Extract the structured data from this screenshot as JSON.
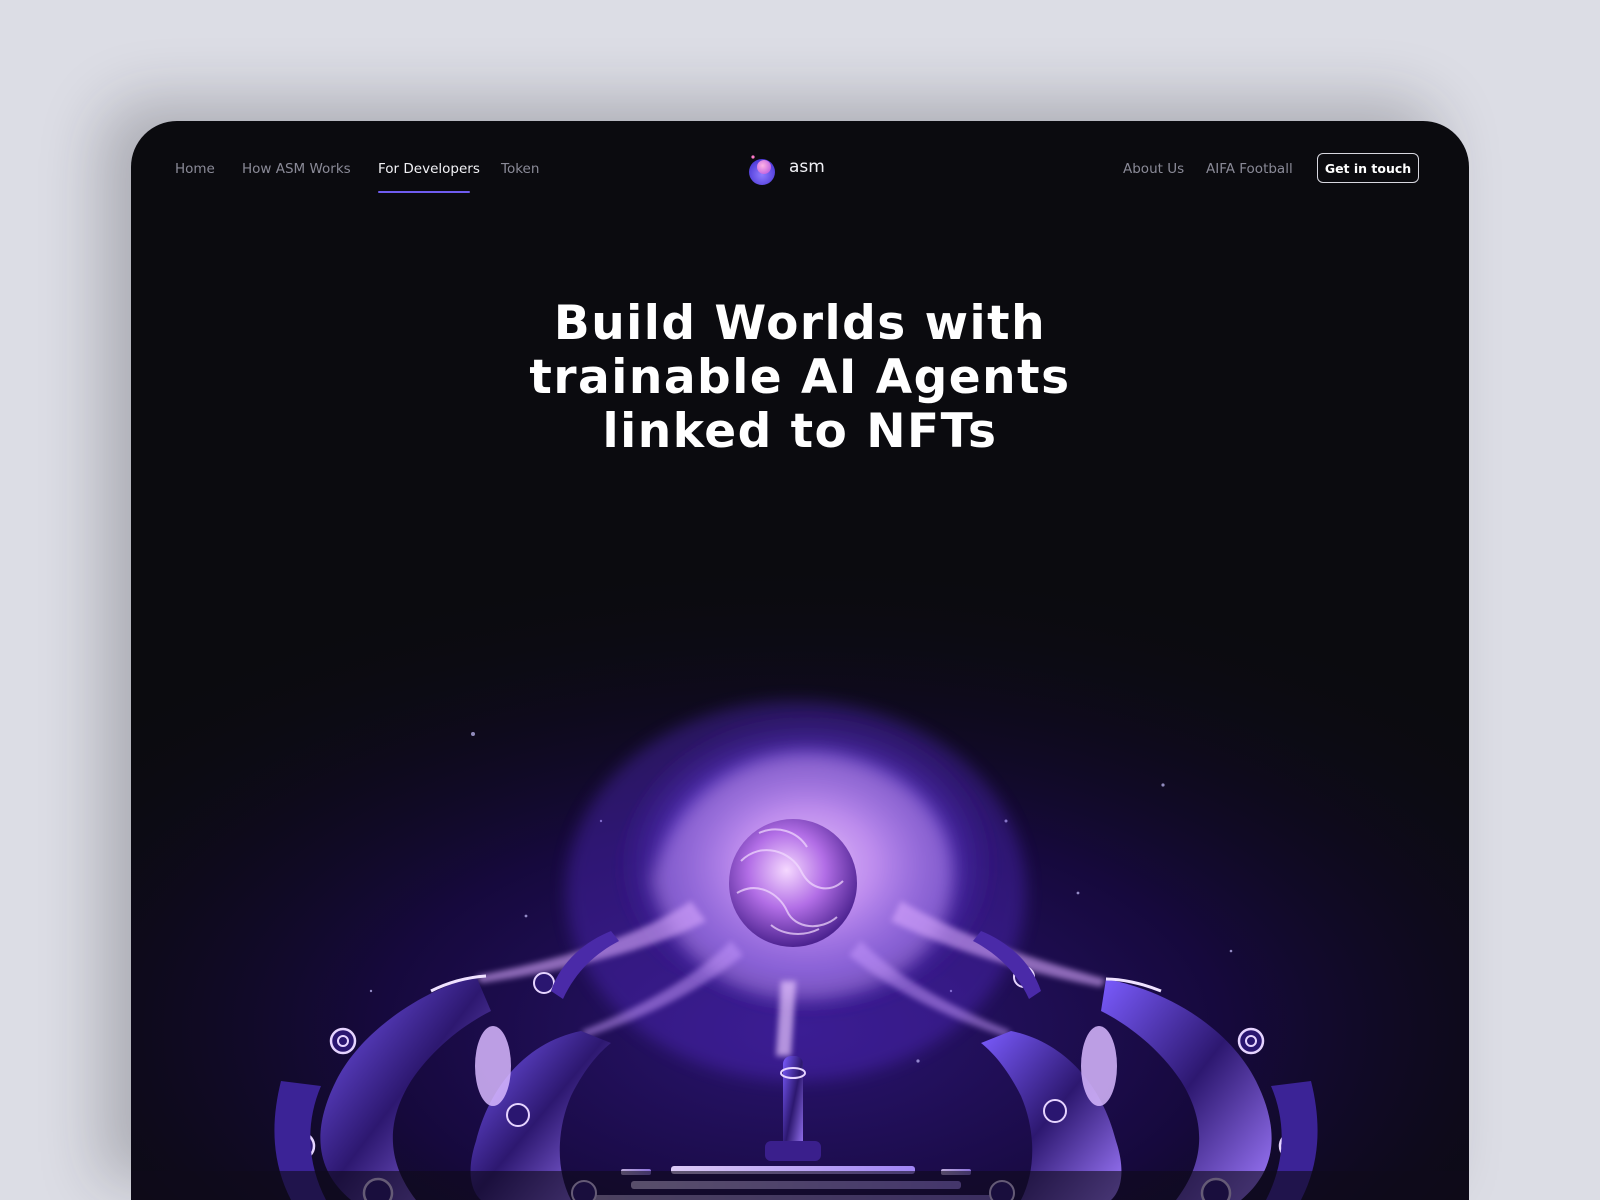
{
  "nav": {
    "left_links": [
      {
        "label": "Home",
        "active": false
      },
      {
        "label": "How ASM Works",
        "active": false
      },
      {
        "label": "For Developers",
        "active": true
      },
      {
        "label": "Token",
        "active": false
      }
    ],
    "logo_text": "asm",
    "right_links": [
      {
        "label": "About Us"
      },
      {
        "label": "AIFA Football"
      }
    ],
    "cta_label": "Get in touch"
  },
  "hero": {
    "title_lines": [
      "Build Worlds with",
      "trainable AI Agents",
      "linked to NFTs"
    ]
  },
  "colors": {
    "page_background": "#dcdde5",
    "frame_background": "#0b0b0f",
    "accent": "#6f5cf0",
    "glow": "#b38cff"
  },
  "icons": {
    "logo": "asm-orb-logo-icon"
  }
}
